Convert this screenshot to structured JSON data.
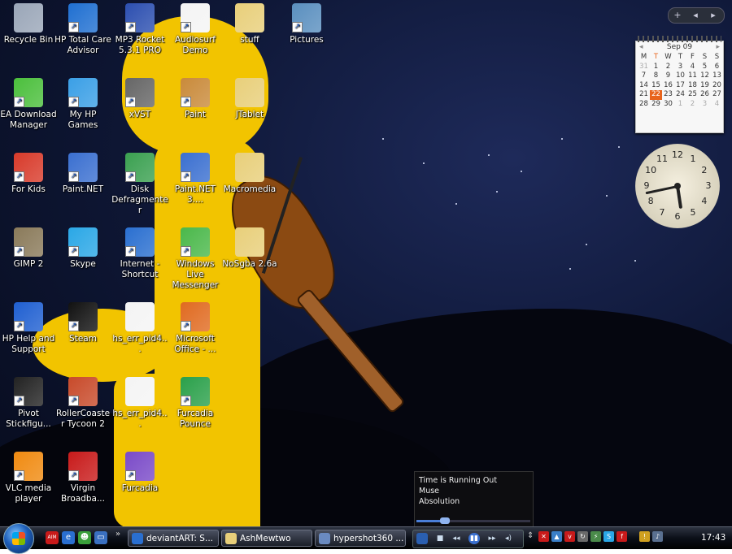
{
  "desktop_icons": [
    {
      "id": "recycle-bin",
      "label": "Recycle Bin",
      "color": "#9aa6b8",
      "shortcut": false
    },
    {
      "id": "hp-total-care",
      "label": "HP Total Care Advisor",
      "color": "#1f6fd1",
      "shortcut": true
    },
    {
      "id": "mp3-rocket",
      "label": "MP3 Rocket 5.3.1 PRO",
      "color": "#2c4fb0",
      "shortcut": true
    },
    {
      "id": "audiosurf-demo",
      "label": "Audiosurf Demo",
      "color": "#f4f4f4",
      "shortcut": true
    },
    {
      "id": "stuff",
      "label": "stuff",
      "color": "#e8cf7a",
      "shortcut": false
    },
    {
      "id": "pictures",
      "label": "Pictures",
      "color": "#5a8fbf",
      "shortcut": true
    },
    {
      "id": "ea-download-manager",
      "label": "EA Download Manager",
      "color": "#4bbf3c",
      "shortcut": true
    },
    {
      "id": "my-hp-games",
      "label": "My HP Games",
      "color": "#3a9fe6",
      "shortcut": true
    },
    {
      "id": "xvst",
      "label": "xVST",
      "color": "#666666",
      "shortcut": true
    },
    {
      "id": "paint",
      "label": "Paint",
      "color": "#c98a3a",
      "shortcut": true
    },
    {
      "id": "jtablet",
      "label": "JTablet",
      "color": "#e8cf7a",
      "shortcut": false
    },
    {
      "id": "for-kids",
      "label": "For Kids",
      "color": "#d83a2a",
      "shortcut": true
    },
    {
      "id": "paint-net",
      "label": "Paint.NET",
      "color": "#3a6fd0",
      "shortcut": true
    },
    {
      "id": "disk-defragmenter",
      "label": "Disk Defragmenter",
      "color": "#3aa050",
      "shortcut": true
    },
    {
      "id": "paint-net-3",
      "label": "Paint.NET 3....",
      "color": "#3a6fd0",
      "shortcut": true
    },
    {
      "id": "macromedia",
      "label": "Macromedia",
      "color": "#e8cf7a",
      "shortcut": false
    },
    {
      "id": "gimp-2",
      "label": "GIMP 2",
      "color": "#8a7a5a",
      "shortcut": true
    },
    {
      "id": "skype",
      "label": "Skype",
      "color": "#2aa7e6",
      "shortcut": true
    },
    {
      "id": "internet-shortcut",
      "label": "Internet - Shortcut",
      "color": "#2a6fd0",
      "shortcut": true
    },
    {
      "id": "windows-live-messenger",
      "label": "Windows Live Messenger",
      "color": "#4ab84a",
      "shortcut": true
    },
    {
      "id": "nosgba",
      "label": "NoSgba 2.6a",
      "color": "#e8cf7a",
      "shortcut": false
    },
    {
      "id": "hp-help-support",
      "label": "HP Help and Support",
      "color": "#1f5fd1",
      "shortcut": true
    },
    {
      "id": "steam",
      "label": "Steam",
      "color": "#111111",
      "shortcut": true
    },
    {
      "id": "hs-err-1",
      "label": "hs_err_pid4...",
      "color": "#f4f4f4",
      "shortcut": false
    },
    {
      "id": "microsoft-office",
      "label": "Microsoft Office - ...",
      "color": "#e06a20",
      "shortcut": true
    },
    {
      "id": "pivot-stickfigure",
      "label": "Pivot Stickfigu...",
      "color": "#222222",
      "shortcut": true
    },
    {
      "id": "rollercoaster-tycoon-2",
      "label": "RollerCoaster Tycoon 2",
      "color": "#c84a2a",
      "shortcut": true
    },
    {
      "id": "hs-err-2",
      "label": "hs_err_pid4...",
      "color": "#f4f4f4",
      "shortcut": false
    },
    {
      "id": "furcadia-pounce",
      "label": "Furcadia Pounce",
      "color": "#2aa04a",
      "shortcut": true
    },
    {
      "id": "vlc",
      "label": "VLC media player",
      "color": "#f08a10",
      "shortcut": true
    },
    {
      "id": "virgin-broadband",
      "label": "Virgin Broadba...",
      "color": "#c81a1a",
      "shortcut": true
    },
    {
      "id": "furcadia",
      "label": "Furcadia",
      "color": "#7a4ac8",
      "shortcut": true
    }
  ],
  "sidebar": {
    "controls": [
      "+",
      "◂",
      "▸"
    ],
    "calendar": {
      "month": "Sep 09",
      "prev": "◂",
      "next": "▸",
      "weekdays": [
        "M",
        "T",
        "W",
        "T",
        "F",
        "S",
        "S"
      ],
      "rows": [
        [
          "31",
          "1",
          "2",
          "3",
          "4",
          "5",
          "6"
        ],
        [
          "7",
          "8",
          "9",
          "10",
          "11",
          "12",
          "13"
        ],
        [
          "14",
          "15",
          "16",
          "17",
          "18",
          "19",
          "20"
        ],
        [
          "21",
          "22",
          "23",
          "24",
          "25",
          "26",
          "27"
        ],
        [
          "28",
          "29",
          "30",
          "1",
          "2",
          "3",
          "4"
        ]
      ],
      "today": "22"
    },
    "clock": {
      "numbers": [
        "12",
        "1",
        "2",
        "3",
        "4",
        "5",
        "6",
        "7",
        "8",
        "9",
        "10",
        "11"
      ],
      "hour": 5,
      "minute": 43
    }
  },
  "media_popup": {
    "title": "Time is Running Out",
    "artist": "Muse",
    "album": "Absolution",
    "progress": 0.25
  },
  "taskbar": {
    "quick_launch": [
      {
        "name": "aim-icon",
        "glyph": "AIM",
        "color": "#c81a1a"
      },
      {
        "name": "ie-icon",
        "glyph": "e",
        "color": "#2a6fd0"
      },
      {
        "name": "messenger-icon",
        "glyph": "☻",
        "color": "#3aa03a"
      },
      {
        "name": "show-desktop-icon",
        "glyph": "▭",
        "color": "#3a70c0"
      }
    ],
    "overflow": "»",
    "tasks": [
      {
        "name": "task-deviantart",
        "label": "deviantART: S...",
        "color": "#2a6fd0"
      },
      {
        "name": "task-ashmewtwo",
        "label": "AshMewtwo",
        "color": "#e8cf7a"
      },
      {
        "name": "task-hypershot",
        "label": "hypershot360 ...",
        "color": "#6a8ac0"
      }
    ],
    "wmp_controls": [
      "■",
      "◂◂",
      "▮▮",
      "▸▸",
      "◂)"
    ],
    "tray_icons": [
      {
        "name": "tray-shield-icon",
        "color": "#c81a1a",
        "glyph": "✕"
      },
      {
        "name": "tray-network-icon",
        "color": "#3a7fc8",
        "glyph": "▲"
      },
      {
        "name": "tray-virgin-icon",
        "color": "#c81a1a",
        "glyph": "v"
      },
      {
        "name": "tray-sync-icon",
        "color": "#6a6a6a",
        "glyph": "↻"
      },
      {
        "name": "tray-power-icon",
        "color": "#4a8a4a",
        "glyph": "⚡"
      },
      {
        "name": "tray-skype-icon",
        "color": "#2aa7e6",
        "glyph": "S"
      },
      {
        "name": "tray-flash-icon",
        "color": "#c81a1a",
        "glyph": "f"
      },
      {
        "name": "tray-alert-icon",
        "color": "#d0a020",
        "glyph": "!"
      },
      {
        "name": "tray-volume-icon",
        "color": "#5a7090",
        "glyph": "♪"
      }
    ],
    "time": "17:43"
  }
}
